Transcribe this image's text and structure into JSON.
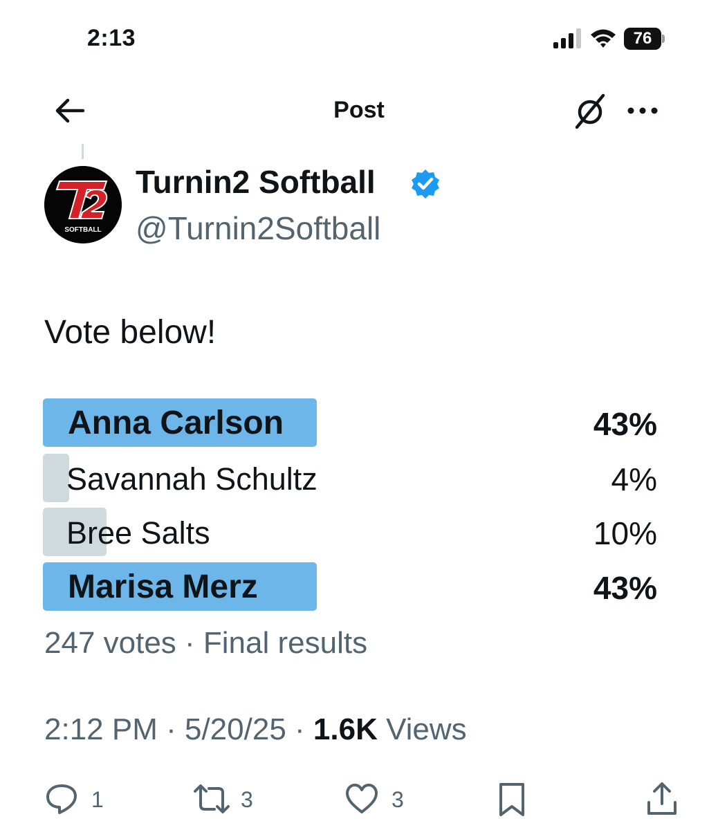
{
  "status_bar": {
    "time": "2:13",
    "battery_level": "76",
    "signal_bars": 3
  },
  "nav": {
    "title": "Post"
  },
  "author": {
    "display_name": "Turnin2 Softball",
    "handle": "@Turnin2Softball",
    "verified": true,
    "avatar": {
      "logo_text": "T2",
      "caption": "SOFTBALL"
    }
  },
  "post": {
    "text": "Vote below!"
  },
  "poll": {
    "options": [
      {
        "label": "Anna Carlson",
        "percent_label": "43%",
        "percent": 43,
        "winner": true
      },
      {
        "label": "Savannah Schultz",
        "percent_label": "4%",
        "percent": 4,
        "winner": false
      },
      {
        "label": "Bree Salts",
        "percent_label": "10%",
        "percent": 10,
        "winner": false
      },
      {
        "label": "Marisa Merz",
        "percent_label": "43%",
        "percent": 43,
        "winner": true
      }
    ],
    "summary": "247 votes · Final results"
  },
  "meta": {
    "time": "2:12 PM",
    "separator": " · ",
    "date": "5/20/25",
    "views_count": "1.6K",
    "views_label": " Views"
  },
  "actions": {
    "reply_count": "1",
    "repost_count": "3",
    "like_count": "3"
  },
  "colors": {
    "winner_bar": "#6cb6e9",
    "loser_bar": "#cfd9de",
    "verified": "#1d9bf0",
    "secondary_text": "#536471",
    "logo_red": "#d42027"
  },
  "icons": {
    "back": "arrow-left-icon",
    "grok": "grok-icon",
    "more": "more-horizontal-icon",
    "verified": "verified-badge-icon",
    "reply": "reply-icon",
    "repost": "repost-icon",
    "like": "heart-icon",
    "bookmark": "bookmark-icon",
    "share": "share-icon"
  }
}
